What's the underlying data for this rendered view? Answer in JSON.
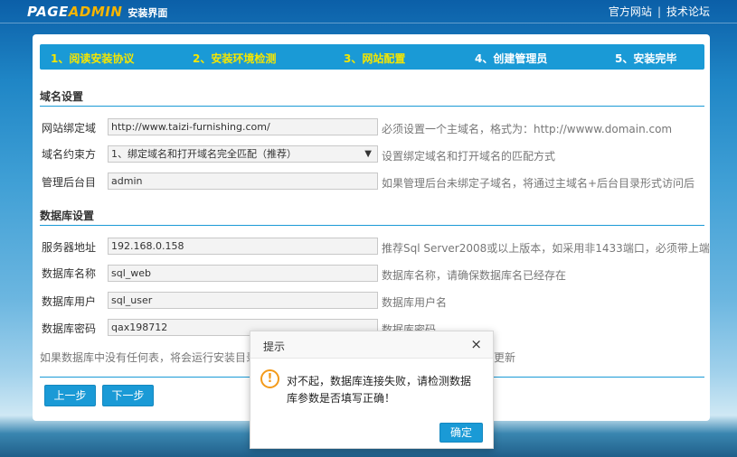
{
  "header": {
    "logo_page": "PAGE",
    "logo_admin": "ADMIN",
    "logo_sub": "安装界面",
    "link_official": "官方网站",
    "link_separator": "|",
    "link_forum": "技术论坛"
  },
  "steps": [
    {
      "label": "1、阅读安装协议"
    },
    {
      "label": "2、安装环境检测"
    },
    {
      "label": "3、网站配置"
    },
    {
      "label": "4、创建管理员"
    },
    {
      "label": "5、安装完毕"
    }
  ],
  "domain_section": {
    "title": "域名设置",
    "bind_domain": {
      "label": "网站绑定域",
      "value": "http://www.taizi-furnishing.com/",
      "hint": "必须设置一个主域名，格式为：http://wwww.domain.com"
    },
    "domain_constraint": {
      "label": "域名约束方",
      "value": "1、绑定域名和打开域名完全匹配（推荐）",
      "hint": "设置绑定域名和打开域名的匹配方式"
    },
    "admin_dir": {
      "label": "管理后台目",
      "value": "admin",
      "hint": "如果管理后台未绑定子域名，将通过主域名+后台目录形式访问后"
    }
  },
  "db_section": {
    "title": "数据库设置",
    "server": {
      "label": "服务器地址",
      "value": "192.168.0.158",
      "hint": "推荐Sql Server2008或以上版本，如采用非1433端口，必须带上端"
    },
    "db_name": {
      "label": "数据库名称",
      "value": "sql_web",
      "hint": "数据库名称，请确保数据库名已经存在"
    },
    "db_user": {
      "label": "数据库用户",
      "value": "sql_user",
      "hint": "数据库用户名"
    },
    "db_password": {
      "label": "数据库密码",
      "value": "qax198712",
      "hint": "数据库密码"
    },
    "note_left": "如果数据库中没有任何表，将会运行安装目录",
    "note_right": "更新"
  },
  "buttons": {
    "prev": "上一步",
    "next": "下一步"
  },
  "dialog": {
    "title": "提示",
    "close": "×",
    "icon": "!",
    "message": "对不起，数据库连接失败，请检测数据库参数是否填写正确！",
    "ok": "确定"
  }
}
